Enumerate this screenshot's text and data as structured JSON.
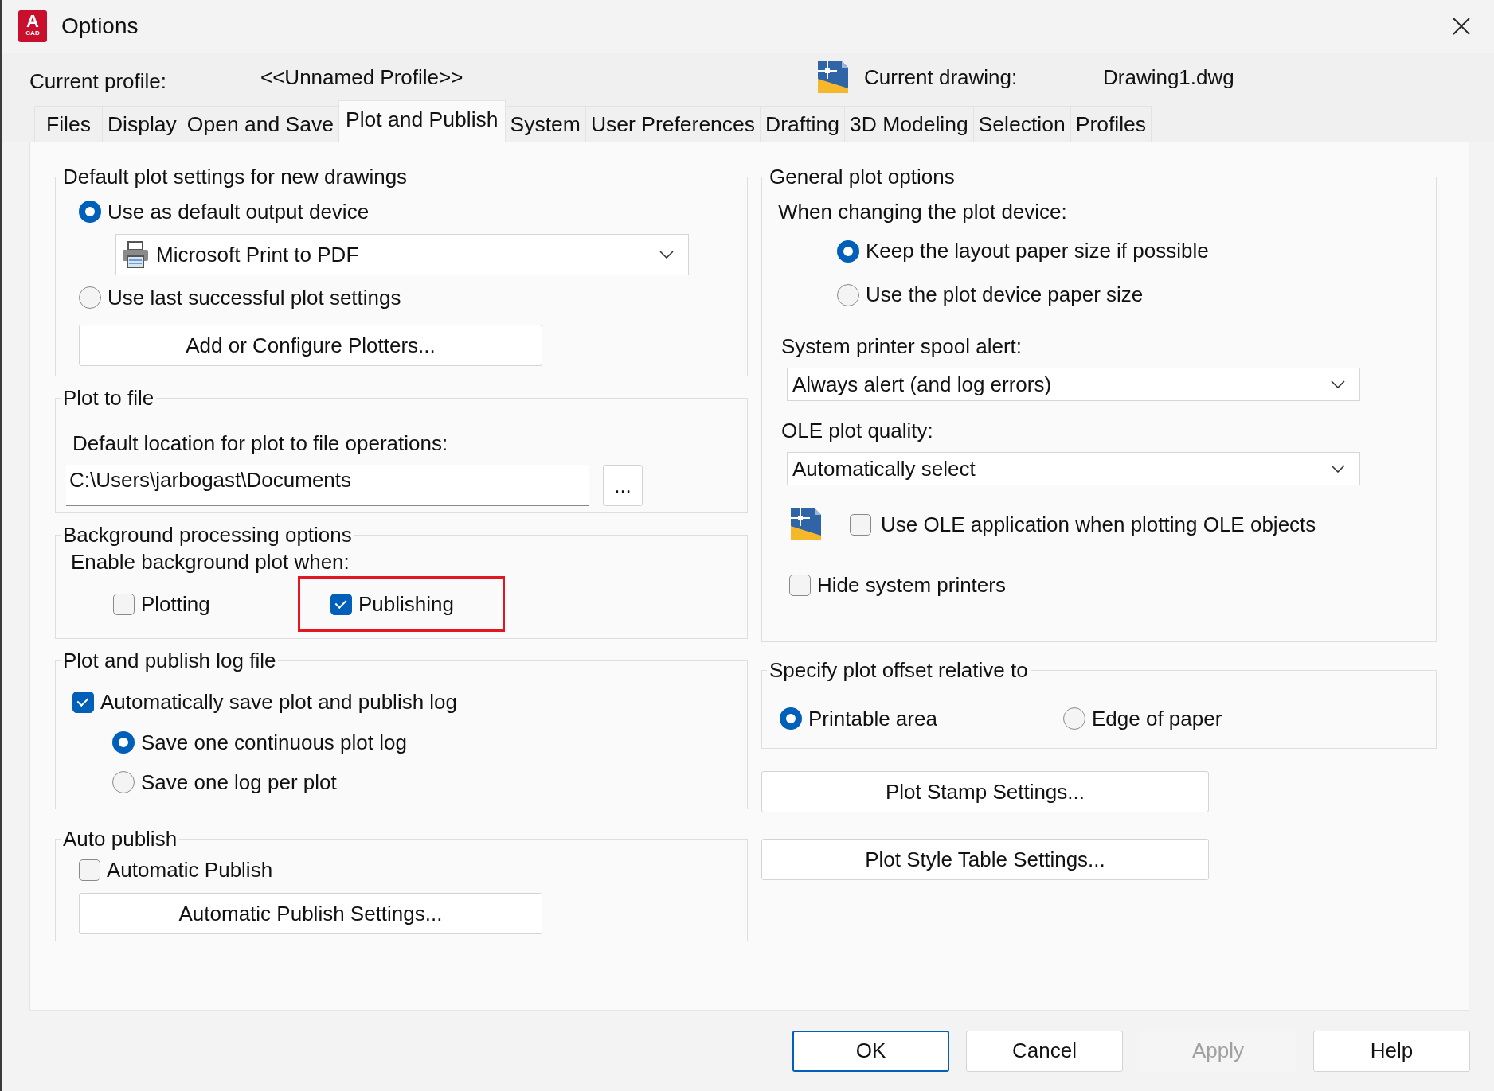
{
  "window": {
    "title": "Options",
    "app_icon": {
      "letter": "A",
      "caption": "CAD"
    }
  },
  "header": {
    "profile_label": "Current profile:",
    "profile_value": "<<Unnamed Profile>>",
    "drawing_label": "Current drawing:",
    "drawing_value": "Drawing1.dwg"
  },
  "tabs": [
    {
      "label": "Files",
      "selected": false
    },
    {
      "label": "Display",
      "selected": false
    },
    {
      "label": "Open and Save",
      "selected": false
    },
    {
      "label": "Plot and Publish",
      "selected": true
    },
    {
      "label": "System",
      "selected": false
    },
    {
      "label": "User Preferences",
      "selected": false
    },
    {
      "label": "Drafting",
      "selected": false
    },
    {
      "label": "3D Modeling",
      "selected": false
    },
    {
      "label": "Selection",
      "selected": false
    },
    {
      "label": "Profiles",
      "selected": false
    }
  ],
  "default_plot_settings": {
    "title": "Default plot settings for new drawings",
    "options": [
      {
        "label": "Use as default output device",
        "selected": true
      },
      {
        "label": "Use last successful plot settings",
        "selected": false
      }
    ],
    "device": "Microsoft Print to PDF",
    "button": "Add or Configure Plotters..."
  },
  "plot_to_file": {
    "title": "Plot to file",
    "label": "Default location for plot to file operations:",
    "path": "C:\\Users\\jarbogast\\Documents",
    "browse_button": "..."
  },
  "background_processing": {
    "title": "Background processing options",
    "label": "Enable background plot when:",
    "options": [
      {
        "label": "Plotting",
        "checked": false,
        "highlighted": false
      },
      {
        "label": "Publishing",
        "checked": true,
        "highlighted": true
      }
    ]
  },
  "log_file": {
    "title": "Plot and publish log file",
    "auto_save": {
      "label": "Automatically save plot and publish log",
      "checked": true
    },
    "options": [
      {
        "label": "Save one continuous plot log",
        "selected": true
      },
      {
        "label": "Save one log per plot",
        "selected": false
      }
    ]
  },
  "auto_publish": {
    "title": "Auto publish",
    "checkbox": {
      "label": "Automatic Publish",
      "checked": false
    },
    "button": "Automatic Publish Settings..."
  },
  "general_plot_options": {
    "title": "General plot options",
    "device_label": "When changing the plot device:",
    "paper_options": [
      {
        "label": "Keep the layout paper size if possible",
        "selected": true
      },
      {
        "label": "Use the plot device paper size",
        "selected": false
      }
    ],
    "spool_label": "System printer spool alert:",
    "spool_value": "Always alert (and log errors)",
    "ole_label": "OLE plot quality:",
    "ole_value": "Automatically select",
    "ole_app": {
      "label": "Use OLE application when plotting OLE objects",
      "checked": false
    },
    "hide_printers": {
      "label": "Hide system printers",
      "checked": false
    }
  },
  "plot_offset": {
    "title": "Specify plot offset relative to",
    "options": [
      {
        "label": "Printable area",
        "selected": true
      },
      {
        "label": "Edge of paper",
        "selected": false
      }
    ]
  },
  "side_buttons": [
    "Plot Stamp Settings...",
    "Plot Style Table Settings..."
  ],
  "footer_buttons": [
    {
      "label": "OK",
      "default": true,
      "disabled": false
    },
    {
      "label": "Cancel",
      "default": false,
      "disabled": false
    },
    {
      "label": "Apply",
      "default": false,
      "disabled": true
    },
    {
      "label": "Help",
      "default": false,
      "disabled": false
    }
  ]
}
